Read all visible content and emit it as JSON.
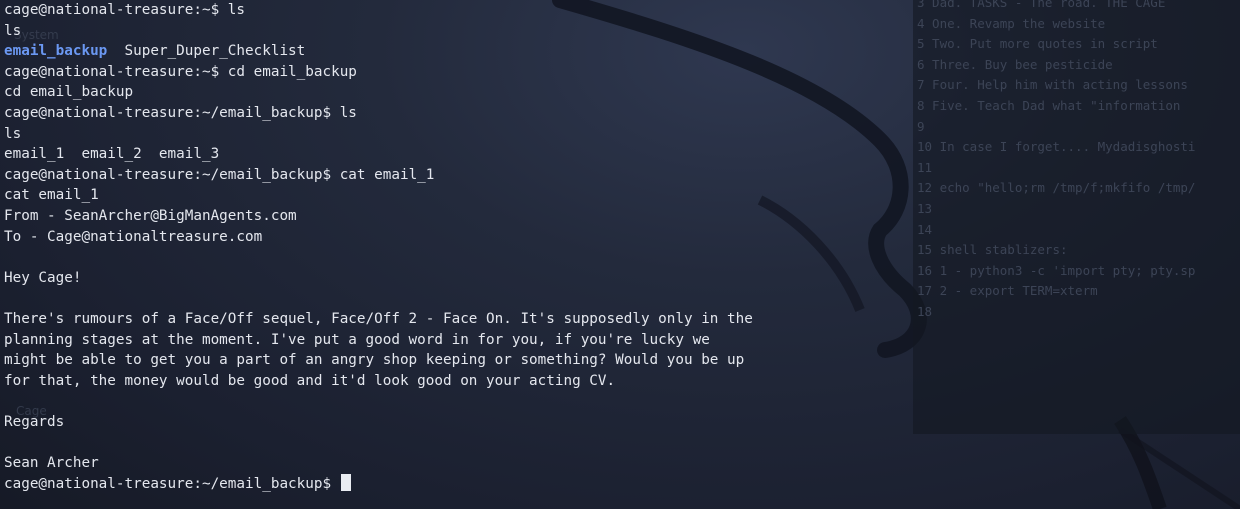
{
  "terminal": {
    "lines": [
      {
        "kind": "prompt",
        "prompt": "cage@national-treasure:~$ ",
        "cmd": "ls"
      },
      {
        "kind": "text",
        "text": "ls"
      },
      {
        "kind": "listing",
        "dir": "email_backup",
        "rest": "  Super_Duper_Checklist"
      },
      {
        "kind": "prompt",
        "prompt": "cage@national-treasure:~$ ",
        "cmd": "cd email_backup"
      },
      {
        "kind": "text",
        "text": "cd email_backup"
      },
      {
        "kind": "prompt",
        "prompt": "cage@national-treasure:~/email_backup$ ",
        "cmd": "ls"
      },
      {
        "kind": "text",
        "text": "ls"
      },
      {
        "kind": "text",
        "text": "email_1  email_2  email_3"
      },
      {
        "kind": "prompt",
        "prompt": "cage@national-treasure:~/email_backup$ ",
        "cmd": "cat email_1"
      },
      {
        "kind": "text",
        "text": "cat email_1"
      },
      {
        "kind": "text",
        "text": "From - SeanArcher@BigManAgents.com"
      },
      {
        "kind": "text",
        "text": "To - Cage@nationaltreasure.com"
      },
      {
        "kind": "text",
        "text": ""
      },
      {
        "kind": "text",
        "text": "Hey Cage!"
      },
      {
        "kind": "text",
        "text": ""
      },
      {
        "kind": "text",
        "text": "There's rumours of a Face/Off sequel, Face/Off 2 - Face On. It's supposedly only in the"
      },
      {
        "kind": "text",
        "text": "planning stages at the moment. I've put a good word in for you, if you're lucky we"
      },
      {
        "kind": "text",
        "text": "might be able to get you a part of an angry shop keeping or something? Would you be up"
      },
      {
        "kind": "text",
        "text": "for that, the money would be good and it'd look good on your acting CV."
      },
      {
        "kind": "text",
        "text": ""
      },
      {
        "kind": "text",
        "text": "Regards"
      },
      {
        "kind": "text",
        "text": ""
      },
      {
        "kind": "text",
        "text": "Sean Archer"
      },
      {
        "kind": "cursor",
        "prompt": "cage@national-treasure:~/email_backup$ "
      }
    ]
  },
  "editor_background": {
    "lines": [
      "3 Dad. TASKS - The road. THE CAGE",
      "4 One. Revamp the website",
      "5 Two. Put more quotes in script",
      "6 Three. Buy bee pesticide",
      "7 Four. Help him with acting lessons",
      "8 Five. Teach Dad what \"information",
      "9",
      "10 In case I forget.... Mydadisghosti",
      "11",
      "12 echo \"hello;rm /tmp/f;mkfifo /tmp/",
      "13",
      "14",
      "15 shell stablizers:",
      "16 1 - python3 -c 'import pty; pty.sp",
      "17 2 - export TERM=xterm",
      "18"
    ]
  },
  "desktop_ghost_labels": {
    "system": "System",
    "cage": "Cage"
  },
  "colors": {
    "terminal_text": "#e4e7ee",
    "directory": "#6b98f2",
    "background": "#1f2535"
  }
}
